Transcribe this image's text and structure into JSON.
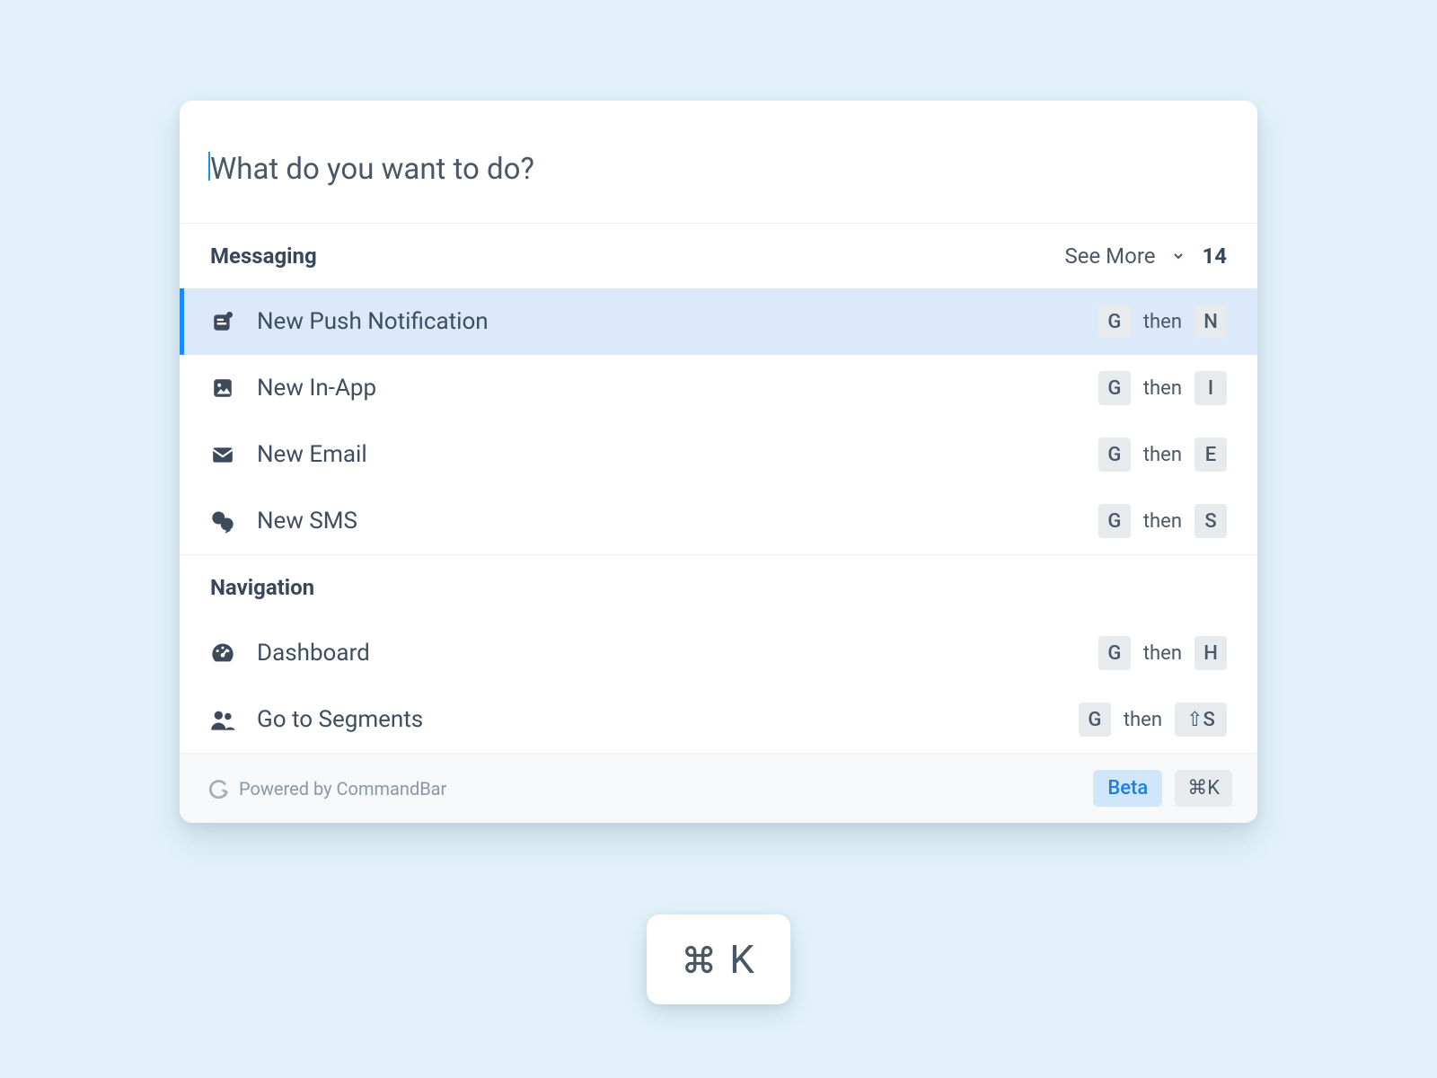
{
  "search": {
    "placeholder": "What do you want to do?"
  },
  "sections": [
    {
      "title": "Messaging",
      "seeMore": {
        "label": "See More",
        "count": "14"
      },
      "items": [
        {
          "label": "New Push Notification",
          "shortcut": {
            "key1": "G",
            "then": "then",
            "key2": "N"
          },
          "active": true,
          "icon": "push-icon"
        },
        {
          "label": "New In-App",
          "shortcut": {
            "key1": "G",
            "then": "then",
            "key2": "I"
          },
          "icon": "inapp-icon"
        },
        {
          "label": "New Email",
          "shortcut": {
            "key1": "G",
            "then": "then",
            "key2": "E"
          },
          "icon": "email-icon"
        },
        {
          "label": "New SMS",
          "shortcut": {
            "key1": "G",
            "then": "then",
            "key2": "S"
          },
          "icon": "sms-icon"
        }
      ]
    },
    {
      "title": "Navigation",
      "items": [
        {
          "label": "Dashboard",
          "shortcut": {
            "key1": "G",
            "then": "then",
            "key2": "H"
          },
          "icon": "dashboard-icon"
        },
        {
          "label": "Go to Segments",
          "shortcut": {
            "key1": "G",
            "then": "then",
            "key2": "⇧S"
          },
          "icon": "segments-icon"
        }
      ]
    }
  ],
  "footer": {
    "poweredBy": "Powered by CommandBar",
    "beta": "Beta",
    "shortcut": "⌘K"
  },
  "heroShortcut": {
    "key": "K"
  }
}
